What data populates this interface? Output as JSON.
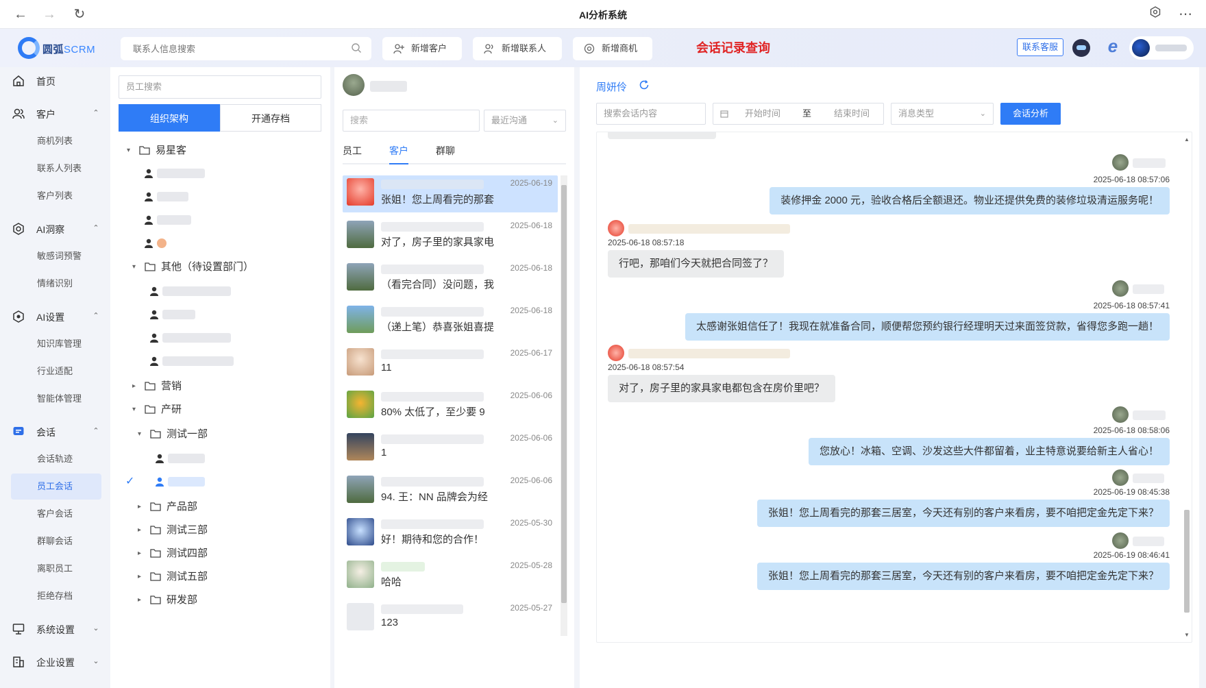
{
  "window": {
    "title": "AI分析系统"
  },
  "header": {
    "brand": "圆弧",
    "brand_suffix": "SCRM",
    "search_placeholder": "联系人信息搜索",
    "buttons": [
      "新增客户",
      "新增联系人",
      "新增商机"
    ],
    "page_heading": "会话记录查询",
    "service_label": "联系客服"
  },
  "nav": {
    "home": "首页",
    "customer": {
      "label": "客户",
      "items": [
        "商机列表",
        "联系人列表",
        "客户列表"
      ]
    },
    "ai_insight": {
      "label": "AI洞察",
      "items": [
        "敏感词预警",
        "情绪识别"
      ]
    },
    "ai_settings": {
      "label": "AI设置",
      "items": [
        "知识库管理",
        "行业适配",
        "智能体管理"
      ]
    },
    "session": {
      "label": "会话",
      "items": [
        "会话轨迹",
        "员工会话",
        "客户会话",
        "群聊会话",
        "离职员工",
        "拒绝存档"
      ],
      "active_index": 1
    },
    "system": "系统设置",
    "enterprise": "企业设置"
  },
  "org": {
    "search_placeholder": "员工搜索",
    "tabs": [
      "组织架构",
      "开通存档"
    ],
    "tree": {
      "root": "易星客",
      "other": "其他（待设置部门）",
      "marketing": "营销",
      "rnd": "产研",
      "test1": "测试一部",
      "product": "产品部",
      "test3": "测试三部",
      "test4": "测试四部",
      "test5": "测试五部",
      "dev": "研发部"
    }
  },
  "chat_list": {
    "search_placeholder": "搜索",
    "sort_select": "最近沟通",
    "tabs": [
      "员工",
      "客户",
      "群聊"
    ],
    "active_tab": 1,
    "items": [
      {
        "date": "2025-06-19",
        "preview": "张姐！您上周看完的那套"
      },
      {
        "date": "2025-06-18",
        "preview": "对了，房子里的家具家电"
      },
      {
        "date": "2025-06-18",
        "preview": "（看完合同）没问题，我"
      },
      {
        "date": "2025-06-18",
        "preview": "（递上笔）恭喜张姐喜提"
      },
      {
        "date": "2025-06-17",
        "preview": "11"
      },
      {
        "date": "2025-06-06",
        "preview": "80% 太低了，至少要 9"
      },
      {
        "date": "2025-06-06",
        "preview": "1"
      },
      {
        "date": "2025-06-06",
        "preview": "94. 王：NN 品牌会为经"
      },
      {
        "date": "2025-05-30",
        "preview": "好！期待和您的合作！"
      },
      {
        "date": "2025-05-28",
        "preview": "哈哈"
      },
      {
        "date": "2025-05-27",
        "preview": "123"
      }
    ]
  },
  "chat": {
    "contact_name": "周妍伶",
    "filters": {
      "content_placeholder": "搜索会话内容",
      "start_placeholder": "开始时间",
      "range_sep": "至",
      "end_placeholder": "结束时间",
      "type_placeholder": "消息类型",
      "analyze_label": "会话分析"
    },
    "messages": [
      {
        "time": "2025-06-18 08:57:06",
        "text": "装修押金 2000 元，验收合格后全额退还。物业还提供免费的装修垃圾清运服务呢！"
      },
      {
        "time": "2025-06-18 08:57:18",
        "text": "行吧，那咱们今天就把合同签了？"
      },
      {
        "time": "2025-06-18 08:57:41",
        "text": "太感谢张姐信任了！我现在就准备合同，顺便帮您预约银行经理明天过来面签贷款，省得您多跑一趟！"
      },
      {
        "time": "2025-06-18 08:57:54",
        "text": "对了，房子里的家具家电都包含在房价里吧？"
      },
      {
        "time": "2025-06-18 08:58:06",
        "text": "您放心！冰箱、空调、沙发这些大件都留着，业主特意说要给新主人省心！"
      },
      {
        "time": "2025-06-19 08:45:38",
        "text": "张姐！您上周看完的那套三居室，今天还有别的客户来看房，要不咱把定金先定下来？"
      },
      {
        "time": "2025-06-19 08:46:41",
        "text": "张姐！您上周看完的那套三居室，今天还有别的客户来看房，要不咱把定金先定下来？"
      }
    ]
  }
}
